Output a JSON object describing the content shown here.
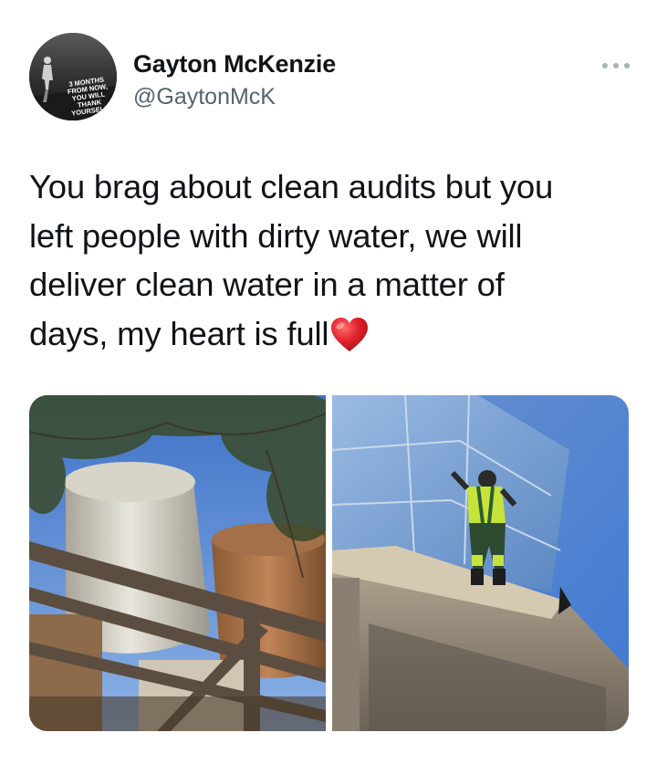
{
  "author": {
    "display_name": "Gayton McKenzie",
    "handle": "@GaytonMcK",
    "avatar_text": [
      "3 MONTHS",
      "FROM NOW,",
      "YOU WILL",
      "THANK",
      "YOURSELF."
    ]
  },
  "tweet": {
    "lines": [
      "You brag about clean audits but you",
      "left people with dirty water, we will",
      "deliver clean water in a matter of",
      "days, my heart is full"
    ],
    "emoji": "heart-emoji"
  },
  "menu": {
    "icon": "more-horizontal-icon"
  },
  "media": {
    "photos": [
      {
        "icon": "photo-water-tanks-under-tree"
      },
      {
        "icon": "photo-worker-on-water-tank"
      }
    ]
  }
}
